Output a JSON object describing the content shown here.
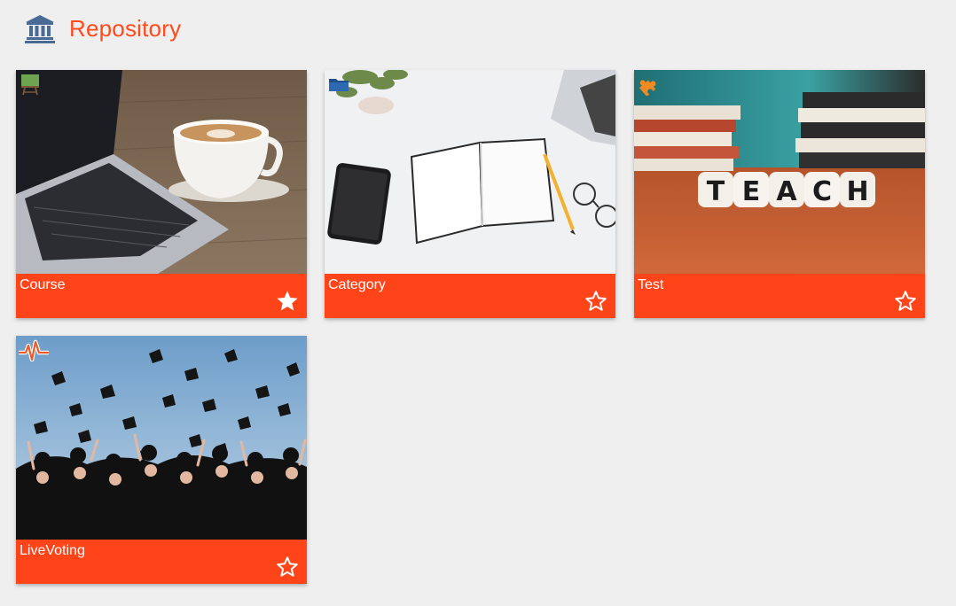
{
  "header": {
    "title": "Repository",
    "icon": "bank-icon"
  },
  "accent_color": "#ff4419",
  "cards": [
    {
      "label": "Course",
      "type_icon": "chalkboard-icon",
      "image": "laptop-coffee-photo",
      "favorite": true
    },
    {
      "label": "Category",
      "type_icon": "folder-icon",
      "image": "desk-notebook-photo",
      "favorite": false
    },
    {
      "label": "Test",
      "type_icon": "puzzle-icon",
      "image": "teach-blocks-photo",
      "favorite": false
    },
    {
      "label": "LiveVoting",
      "type_icon": "pulse-icon",
      "image": "graduation-caps-photo",
      "favorite": false
    }
  ]
}
